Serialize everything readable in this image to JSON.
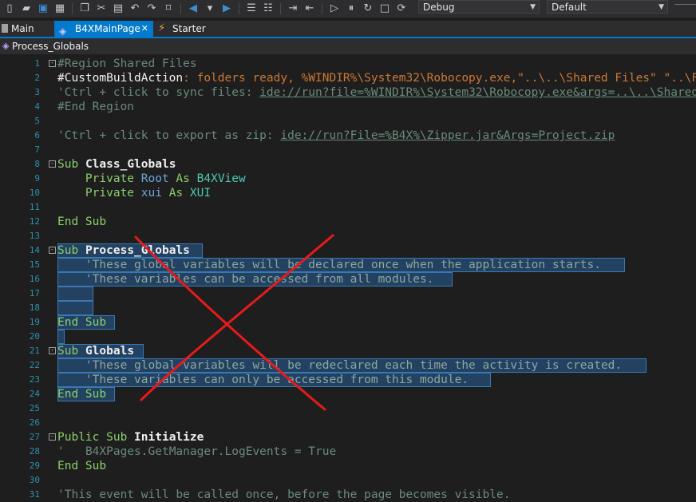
{
  "toolbar": {
    "config_value": "Debug",
    "platform_value": "Default"
  },
  "tabs": [
    {
      "label": "Main"
    },
    {
      "label": "B4XMainPage",
      "close": "✕"
    },
    {
      "label": "Starter"
    }
  ],
  "breadcrumb": "Process_Globals",
  "lines": [
    {
      "n": "1"
    },
    {
      "n": "2"
    },
    {
      "n": "3"
    },
    {
      "n": "4"
    },
    {
      "n": "5"
    },
    {
      "n": "6"
    },
    {
      "n": "7"
    },
    {
      "n": "8"
    },
    {
      "n": "9"
    },
    {
      "n": "10"
    },
    {
      "n": "11"
    },
    {
      "n": "12"
    },
    {
      "n": "13"
    },
    {
      "n": "14"
    },
    {
      "n": "15"
    },
    {
      "n": "16"
    },
    {
      "n": "17"
    },
    {
      "n": "18"
    },
    {
      "n": "19"
    },
    {
      "n": "20"
    },
    {
      "n": "21"
    },
    {
      "n": "22"
    },
    {
      "n": "23"
    },
    {
      "n": "24"
    },
    {
      "n": "25"
    },
    {
      "n": "26"
    },
    {
      "n": "27"
    },
    {
      "n": "28"
    },
    {
      "n": "29"
    },
    {
      "n": "30"
    },
    {
      "n": "31"
    }
  ],
  "code": {
    "l1": {
      "text": "#Region Shared Files"
    },
    "l2": {
      "dir": "#CustomBuildAction",
      "rest": ": folders ready, %WINDIR%\\System32\\Robocopy.exe,\"..\\..\\Shared Files\" \"..\\Files\""
    },
    "l3": {
      "pre": "'Ctrl + click to sync files: ",
      "link": "ide://run?file=%WINDIR%\\System32\\Robocopy.exe&args=..\\..\\Shared+Files&args=..\\Files&FilesSync=True"
    },
    "l4": {
      "text": "#End Region"
    },
    "l6": {
      "pre": "'Ctrl + click to export as zip: ",
      "link": "ide://run?File=%B4X%\\Zipper.jar&Args=Project.zip"
    },
    "l8": {
      "kw": "Sub",
      "name": "Class_Globals"
    },
    "l9": {
      "kw1": "Private",
      "var": "Root",
      "kw2": "As",
      "type": "B4XView"
    },
    "l10": {
      "kw1": "Private",
      "var": "xui",
      "kw2": "As",
      "type": "XUI"
    },
    "l12": {
      "kw": "End Sub"
    },
    "l14": {
      "kw": "Sub",
      "name": "Process_Globals"
    },
    "l15": {
      "text": "'These global variables will be declared once when the application starts."
    },
    "l16": {
      "text": "'These variables can be accessed from all modules."
    },
    "l19": {
      "kw": "End Sub"
    },
    "l21": {
      "kw": "Sub",
      "name": "Globals"
    },
    "l22": {
      "text": "'These global variables will be redeclared each time the activity is created."
    },
    "l23": {
      "text": "'These variables can only be accessed from this module."
    },
    "l24": {
      "kw": "End Sub"
    },
    "l27": {
      "kw": "Public Sub",
      "name": "Initialize"
    },
    "l28": {
      "quote": "'",
      "text": "B4XPages.GetManager.LogEvents = True"
    },
    "l29": {
      "kw": "End Sub"
    },
    "l31": {
      "text": "'This event will be called once, before the page becomes visible."
    }
  }
}
